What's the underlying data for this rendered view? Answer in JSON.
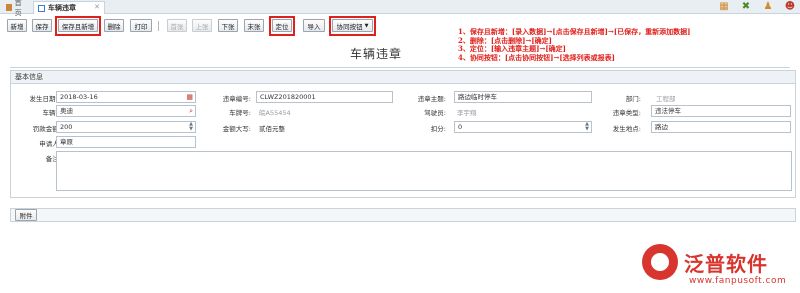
{
  "tabs": {
    "home": "首页",
    "active": "车辆违章"
  },
  "toolbar": {
    "new": "新增",
    "save": "保存",
    "save_new": "保存且新增",
    "delete": "删除",
    "print": "打印",
    "first": "首张",
    "prev": "上张",
    "next": "下张",
    "last": "末张",
    "locate": "定位",
    "import": "导入",
    "collab": "协同按钮"
  },
  "notes": [
    "1、保存且新增：[录入数据]→[点击保存且新增]→[已保存，重新添加数据]",
    "2、删除：[点击删除]→[确定]",
    "3、定位：[输入违章主题]→[确定]",
    "4、协同按钮：[点击协同按钮]→[选择列表或报表]"
  ],
  "page_title": "车辆违章",
  "section_title": "基本信息",
  "form": {
    "date_label": "发生日期*:",
    "date_value": "2018-03-16",
    "code_label": "违章编号:",
    "code_value": "CLWZ201820001",
    "subject_label": "违章主题:",
    "subject_value": "路边临时停车",
    "dept_label": "部门:",
    "dept_value": "工程部",
    "vehicle_label": "车辆*:",
    "vehicle_value": "奥迪",
    "plate_label": "车牌号:",
    "plate_value": "皖A55454",
    "driver_label": "驾驶员:",
    "driver_value": "李宇翔",
    "type_label": "违章类型:",
    "type_value": "违法停车",
    "fine_label": "罚款金额:",
    "fine_value": "200",
    "amount_label": "金额大写:",
    "amount_value": "贰佰元整",
    "points_label": "扣分:",
    "points_value": "0",
    "place_label": "发生地点:",
    "place_value": "路边",
    "applicant_label": "申请人:",
    "applicant_value": "章原",
    "remark_label": "备注:"
  },
  "attach_label": "附件",
  "logo": {
    "name": "泛普软件",
    "url": "www.fanpusoft.com"
  }
}
